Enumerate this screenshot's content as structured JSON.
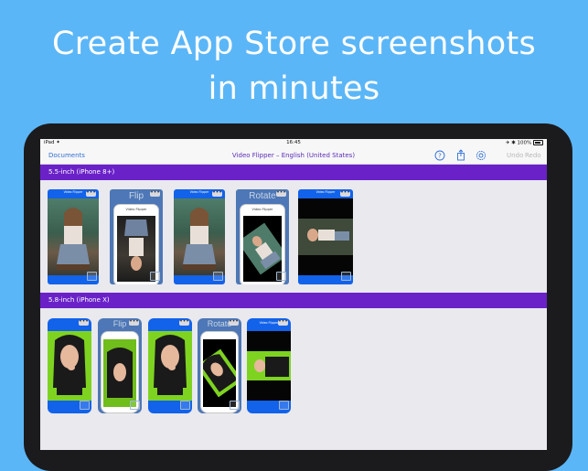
{
  "headline": {
    "line1": "Create App Store screenshots",
    "line2": "in minutes"
  },
  "status_bar": {
    "left": "iPad ✦",
    "time": "16:45",
    "right": "✈ ✱ 100%"
  },
  "nav": {
    "back_label": "Documents",
    "title": "Video Flipper – English (United States)",
    "undo_label": "Undo",
    "redo_label": "Redo"
  },
  "sections": [
    {
      "title": "5.5-inch (iPhone 8+)"
    },
    {
      "title": "5.8-inch (iPhone X)"
    }
  ],
  "thumbs": {
    "app_title": "Video Flipper",
    "flip_label": "Flip",
    "rotate_label": "Rotate",
    "more_label": "•••"
  },
  "colors": {
    "background": "#5bb6f7",
    "section_bar": "#6a22c8",
    "nav_tint": "#2f6fd6",
    "thumb_blue": "#1262ea"
  }
}
